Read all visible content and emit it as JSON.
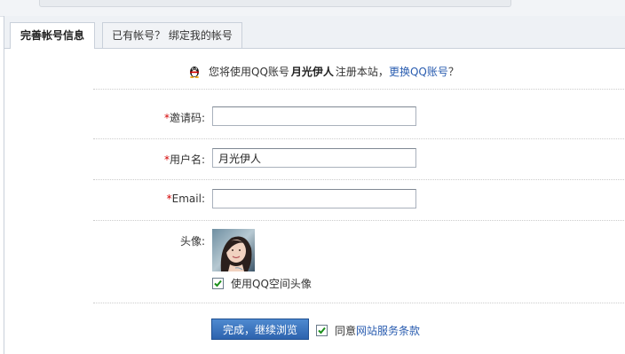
{
  "tabs": [
    {
      "label": "完善帐号信息",
      "active": true
    },
    {
      "label": "已有帐号？ 绑定我的帐号",
      "active": false
    }
  ],
  "info": {
    "prefix": "您将使用QQ账号",
    "account_name": "月光伊人",
    "suffix": "注册本站，",
    "change_link": "更换QQ账号",
    "end": "？",
    "icon": "qq-penguin-icon"
  },
  "form": {
    "required_mark": "*",
    "invite_label": "邀请码:",
    "invite_value": "",
    "username_label": "用户名:",
    "username_value": "月光伊人",
    "email_label": "Email:",
    "email_value": "",
    "avatar_label": "头像:",
    "use_qzone_avatar_label": "使用QQ空间头像",
    "use_qzone_avatar_checked": true
  },
  "actions": {
    "submit_label": "完成，继续浏览",
    "agree_prefix": "同意",
    "terms_link": "网站服务条款",
    "agree_checked": true
  },
  "colors": {
    "link": "#2a5db0",
    "required": "#d40000",
    "button": "#2d63ae"
  }
}
